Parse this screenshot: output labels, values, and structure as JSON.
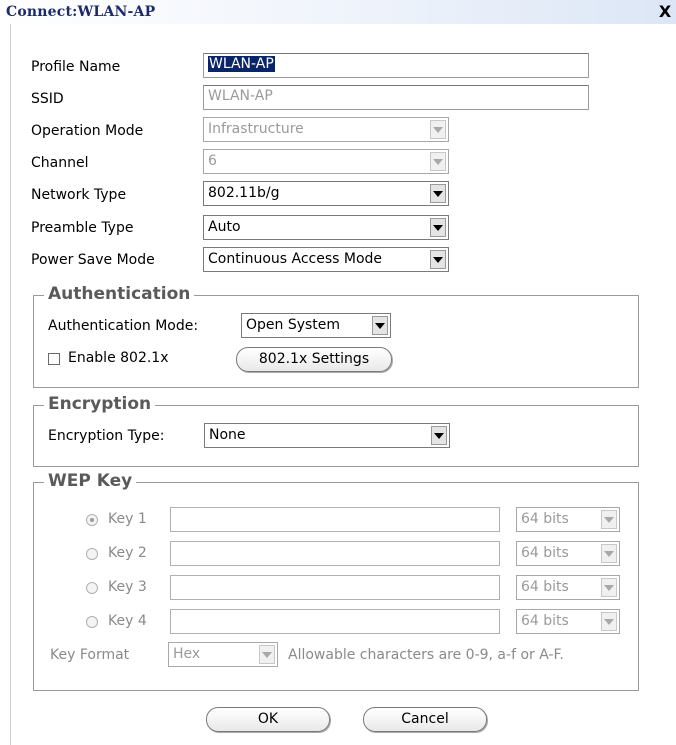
{
  "window": {
    "title": "Connect:WLAN-AP",
    "close_glyph": "X"
  },
  "fields": {
    "profile_name": {
      "label": "Profile Name",
      "value": "WLAN-AP"
    },
    "ssid": {
      "label": "SSID",
      "value": "WLAN-AP"
    },
    "operation_mode": {
      "label": "Operation Mode",
      "value": "Infrastructure"
    },
    "channel": {
      "label": "Channel",
      "value": "6"
    },
    "network_type": {
      "label": "Network Type",
      "value": "802.11b/g"
    },
    "preamble_type": {
      "label": "Preamble Type",
      "value": "Auto"
    },
    "power_save_mode": {
      "label": "Power Save Mode",
      "value": "Continuous Access Mode"
    }
  },
  "authentication": {
    "title": "Authentication",
    "mode_label": "Authentication Mode:",
    "mode_value": "Open System",
    "enable_8021x_label": "Enable 802.1x",
    "settings_button": "802.1x Settings"
  },
  "encryption": {
    "title": "Encryption",
    "type_label": "Encryption Type:",
    "type_value": "None"
  },
  "wep": {
    "title": "WEP Key",
    "keys": [
      {
        "label": "Key 1",
        "value": "",
        "bits": "64 bits",
        "selected": true
      },
      {
        "label": "Key 2",
        "value": "",
        "bits": "64 bits",
        "selected": false
      },
      {
        "label": "Key 3",
        "value": "",
        "bits": "64 bits",
        "selected": false
      },
      {
        "label": "Key 4",
        "value": "",
        "bits": "64 bits",
        "selected": false
      }
    ],
    "format_label": "Key Format",
    "format_value": "Hex",
    "hint": "Allowable characters are 0-9, a-f or A-F."
  },
  "buttons": {
    "ok": "OK",
    "cancel": "Cancel"
  }
}
